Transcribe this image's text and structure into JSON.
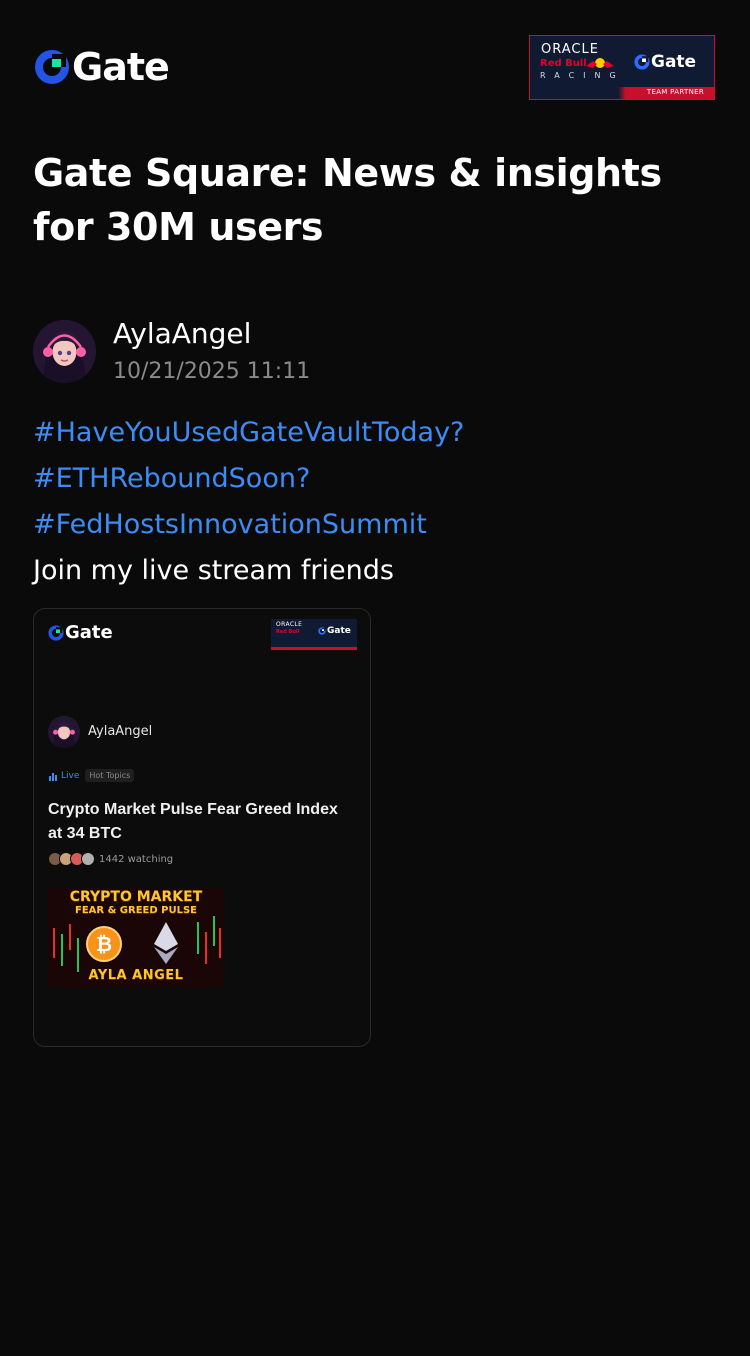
{
  "header": {
    "brand_name": "Gate",
    "partner_badge": {
      "oracle": "ORACLE",
      "red_bull": "Red Bull",
      "racing": "RACING",
      "gate": "Gate",
      "team_partner": "TEAM PARTNER"
    }
  },
  "page": {
    "title": "Gate Square: News & insights for 30M users"
  },
  "post": {
    "author": "AylaAngel",
    "timestamp": "10/21/2025 11:11",
    "hashtags": [
      "#HaveYouUsedGateVaultToday?",
      "#ETHReboundSoon?",
      "#FedHostsInnovationSummit"
    ],
    "text": "Join my live stream friends"
  },
  "card": {
    "brand_name": "Gate",
    "partner_badge": {
      "oracle": "ORACLE",
      "red_bull": "Red Bull",
      "gate": "Gate"
    },
    "author": "AylaAngel",
    "live_label": "Live",
    "topic_label": "Hot Topics",
    "title": "Crypto Market Pulse  Fear   Greed Index at 34  BTC",
    "watching": "1442 watching",
    "thumbnail": {
      "line1": "CRYPTO MARKET",
      "line2": "FEAR & GREED PULSE",
      "line3": "AYLA ANGEL"
    }
  },
  "colors": {
    "background": "#0a0a0a",
    "hashtag": "#3d8cf5",
    "brand_blue": "#2354e6",
    "brand_green": "#17e6a1",
    "muted_text": "#8a8a8a",
    "partner_red": "#c8102e"
  }
}
